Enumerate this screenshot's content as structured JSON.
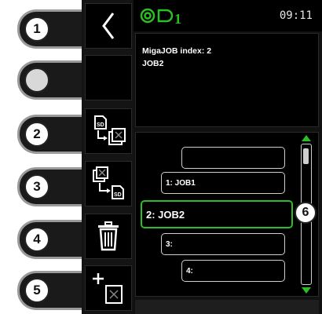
{
  "status": {
    "logo_index": "1",
    "time": "09:11"
  },
  "info": {
    "line1": "MigaJOB index: 2",
    "line2": "JOB2"
  },
  "jobs": {
    "empty": "",
    "job1": "1: JOB1",
    "job2": "2: JOB2",
    "job3": "3:",
    "job4": "4:"
  },
  "callouts": [
    "1",
    "",
    "2",
    "3",
    "4",
    "5",
    "6"
  ],
  "softkeys": [
    {
      "icon": "back-arrow-icon"
    },
    {
      "icon": "blank"
    },
    {
      "icon": "sd-to-job-icon"
    },
    {
      "icon": "job-to-sd-icon"
    },
    {
      "icon": "trash-icon"
    },
    {
      "icon": "add-job-icon"
    }
  ],
  "colors": {
    "accent": "#2dbd27",
    "screen_bg": "#000000"
  }
}
